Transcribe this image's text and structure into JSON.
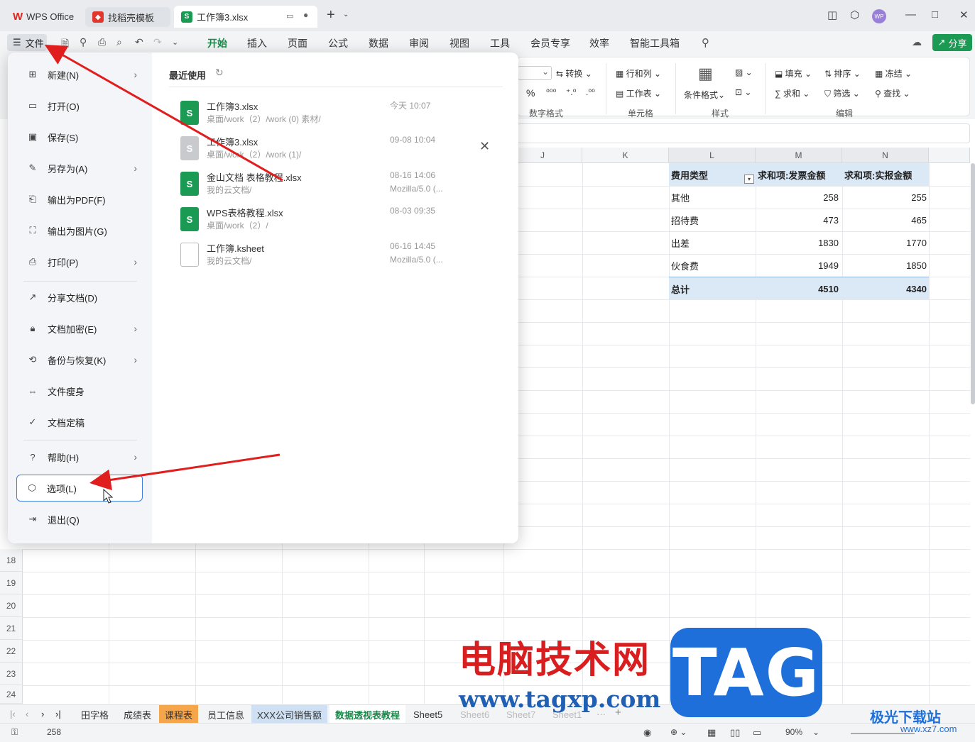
{
  "titlebar": {
    "tabs": [
      {
        "label": "WPS Office"
      },
      {
        "label": "找稻壳模板"
      },
      {
        "label": "工作簿3.xlsx"
      }
    ],
    "avatar": "WP"
  },
  "menubar": {
    "file_label": "文件",
    "tabs": [
      "开始",
      "插入",
      "页面",
      "公式",
      "数据",
      "审阅",
      "视图",
      "工具",
      "会员专享",
      "效率",
      "智能工具箱"
    ],
    "share_label": "分享"
  },
  "ribbon": {
    "convert": "转换",
    "row_col": "行和列",
    "sheet": "工作表",
    "cond_format": "条件格式",
    "fill": "填充",
    "sort": "排序",
    "freeze": "冻结",
    "sum": "求和",
    "filter": "筛选",
    "find": "查找",
    "sections": [
      "数字格式",
      "单元格",
      "样式",
      "编辑"
    ]
  },
  "grid": {
    "columns": [
      "J",
      "K",
      "L",
      "M",
      "N"
    ],
    "rows": [
      "18",
      "19",
      "20",
      "21",
      "22",
      "23",
      "24"
    ]
  },
  "pivot": {
    "headers": [
      "费用类型",
      "求和项:发票金额",
      "求和项:实报金额"
    ],
    "rows": [
      {
        "type": "其他",
        "invoice": "258",
        "reported": "255"
      },
      {
        "type": "招待费",
        "invoice": "473",
        "reported": "465"
      },
      {
        "type": "出差",
        "invoice": "1830",
        "reported": "1770"
      },
      {
        "type": "伙食费",
        "invoice": "1949",
        "reported": "1850"
      }
    ],
    "total": {
      "label": "总计",
      "invoice": "4510",
      "reported": "4340"
    }
  },
  "file_menu": {
    "items": [
      {
        "label": "新建(N)",
        "icon": "new-doc-icon",
        "sub": true
      },
      {
        "label": "打开(O)",
        "icon": "folder-icon",
        "sub": false
      },
      {
        "label": "保存(S)",
        "icon": "save-icon",
        "sub": false
      },
      {
        "label": "另存为(A)",
        "icon": "save-as-icon",
        "sub": true
      },
      {
        "label": "输出为PDF(F)",
        "icon": "pdf-icon",
        "sub": false
      },
      {
        "label": "输出为图片(G)",
        "icon": "image-icon",
        "sub": false
      },
      {
        "label": "打印(P)",
        "icon": "print-icon",
        "sub": true
      },
      {
        "label": "分享文档(D)",
        "icon": "share-icon",
        "sub": false
      },
      {
        "label": "文档加密(E)",
        "icon": "lock-doc-icon",
        "sub": true
      },
      {
        "label": "备份与恢复(K)",
        "icon": "backup-icon",
        "sub": true
      },
      {
        "label": "文件瘦身",
        "icon": "compress-icon",
        "sub": false
      },
      {
        "label": "文档定稿",
        "icon": "finalize-icon",
        "sub": false
      },
      {
        "label": "帮助(H)",
        "icon": "help-icon",
        "sub": true
      },
      {
        "label": "选项(L)",
        "icon": "options-icon",
        "sub": false
      },
      {
        "label": "退出(Q)",
        "icon": "exit-icon",
        "sub": false
      }
    ],
    "recent_title": "最近使用",
    "recent": [
      {
        "name": "工作簿3.xlsx",
        "path": "桌面/work（2）/work (0) 素材/",
        "date": "今天  10:07",
        "sub": "",
        "kind": "xlsx"
      },
      {
        "name": "工作簿3.xlsx",
        "path": "桌面/work（2）/work (1)/",
        "date": "09-08 10:04",
        "sub": "",
        "kind": "gray"
      },
      {
        "name": "金山文档 表格教程.xlsx",
        "path": "我的云文档/",
        "date": "08-16 14:06",
        "sub": "Mozilla/5.0 (...",
        "kind": "cloud"
      },
      {
        "name": "WPS表格教程.xlsx",
        "path": "桌面/work（2）/",
        "date": "08-03 09:35",
        "sub": "",
        "kind": "xlsx"
      },
      {
        "name": "工作簿.ksheet",
        "path": "我的云文档/",
        "date": "06-16 14:45",
        "sub": "Mozilla/5.0 (...",
        "kind": "blank"
      }
    ]
  },
  "sheets": [
    "田字格",
    "成绩表",
    "课程表",
    "员工信息",
    "XXX公司销售额",
    "数据透视表教程",
    "Sheet5",
    "Sheet6",
    "Sheet7",
    "Sheet1"
  ],
  "status": {
    "value": "258",
    "zoom": "90%"
  },
  "watermark": {
    "cn": "电脑技术网",
    "url": "www.tagxp.com",
    "tag": "TAG",
    "brand": "极光下载站",
    "brand_url": "www.xz7.com"
  }
}
